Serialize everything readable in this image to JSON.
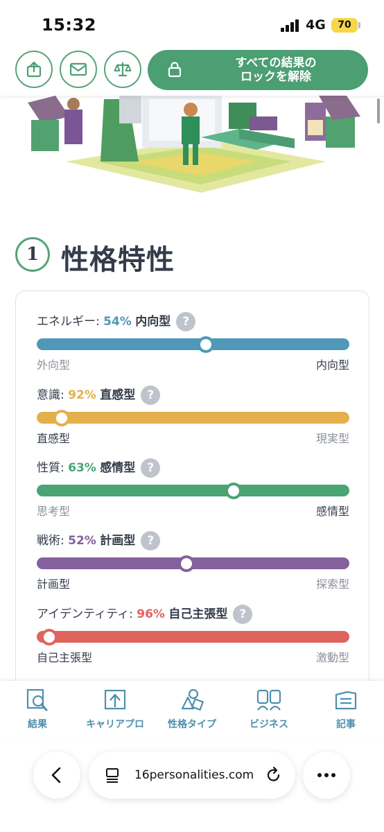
{
  "status": {
    "time": "15:32",
    "network": "4G",
    "battery": "70"
  },
  "header": {
    "unlock_line1": "すべての結果の",
    "unlock_line2": "ロックを解除"
  },
  "section": {
    "number": "1",
    "title": "性格特性"
  },
  "traits": [
    {
      "prefix": "エネルギー: ",
      "percent": "54%",
      "type": "内向型",
      "left": "外向型",
      "right": "内向型",
      "level": 54,
      "color": "#4f98b8",
      "strong_side": "right"
    },
    {
      "prefix": "意識: ",
      "percent": "92%",
      "type": "直感型",
      "left": "直感型",
      "right": "現実型",
      "level": 92,
      "color": "#e3b04b",
      "strong_side": "left"
    },
    {
      "prefix": "性質: ",
      "percent": "63%",
      "type": "感情型",
      "left": "思考型",
      "right": "感情型",
      "level": 63,
      "color": "#4aa474",
      "strong_side": "right"
    },
    {
      "prefix": "戦術: ",
      "percent": "52%",
      "type": "計画型",
      "left": "計画型",
      "right": "探索型",
      "level": 52,
      "color": "#86609c",
      "strong_side": "left"
    },
    {
      "prefix": "アイデンティティ: ",
      "percent": "96%",
      "type": "自己主張型",
      "left": "自己主張型",
      "right": "激動型",
      "level": 96,
      "color": "#e0645e",
      "strong_side": "left"
    }
  ],
  "help_glyph": "?",
  "nav": [
    {
      "label": "結果",
      "icon": "results-icon"
    },
    {
      "label": "キャリアプロ",
      "icon": "career-icon"
    },
    {
      "label": "性格タイプ",
      "icon": "personality-types-icon"
    },
    {
      "label": "ビジネス",
      "icon": "business-icon"
    },
    {
      "label": "記事",
      "icon": "articles-icon"
    }
  ],
  "browser": {
    "url": "16personalities.com"
  }
}
